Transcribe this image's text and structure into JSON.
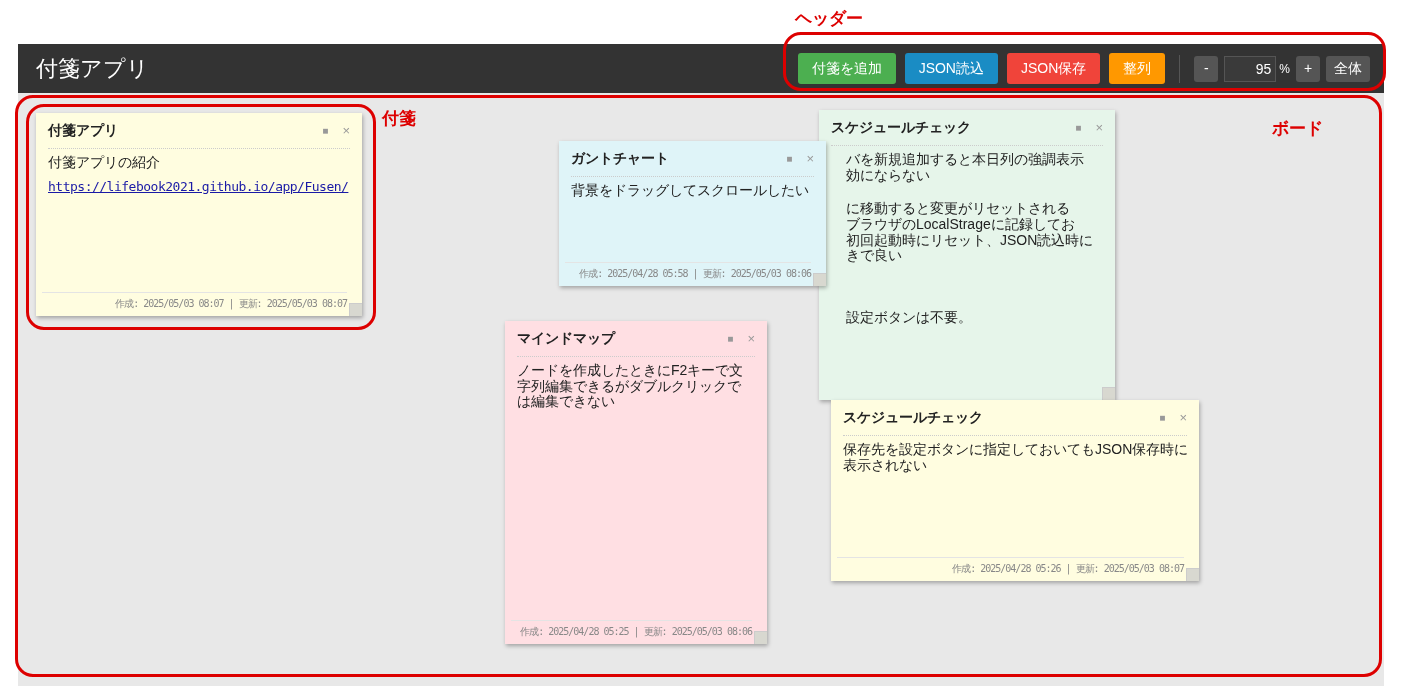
{
  "header": {
    "title": "付箋アプリ",
    "buttons": [
      {
        "label": "付箋を追加",
        "color": "#4caf50"
      },
      {
        "label": "JSON読込",
        "color": "#1a8cc4"
      },
      {
        "label": "JSON保存",
        "color": "#f0443a"
      },
      {
        "label": "整列",
        "color": "#ff9800"
      }
    ],
    "zoom": {
      "minus": "-",
      "value": "95",
      "unit": "%",
      "plus": "+",
      "fit": "全体"
    }
  },
  "notes": [
    {
      "title": "付箋アプリ",
      "color": "#fffde0",
      "minimize": "■",
      "close": "×",
      "paragraphs": [
        {
          "kind": "text",
          "lines": [
            "付箋アプリの紹介"
          ]
        },
        {
          "kind": "link",
          "lines": [
            "https://lifebook2021.github.io/app/Fusen/"
          ]
        }
      ],
      "footer": "作成: 2025/05/03 08:07 | 更新: 2025/05/03 08:07"
    },
    {
      "title": "スケジュールチェック",
      "color": "#e6f5ea",
      "minimize": "■",
      "close": "×",
      "paragraphs": [
        {
          "kind": "text",
          "lines": [
            "バを新規追加すると本日列の強調表示",
            "効にならない"
          ]
        },
        {
          "kind": "text",
          "lines": [
            "に移動すると変更がリセットされる",
            "ブラウザのLocalStrageに記録してお",
            "初回起動時にリセット、JSON読込時に",
            "きで良い"
          ]
        },
        {
          "kind": "text",
          "lines": [
            "設定ボタンは不要。"
          ]
        }
      ]
    },
    {
      "title": "ガントチャート",
      "color": "#dff4f8",
      "minimize": "■",
      "close": "×",
      "paragraphs": [
        {
          "kind": "text",
          "lines": [
            "背景をドラッグしてスクロールしたい"
          ]
        }
      ],
      "footer": "作成: 2025/04/28 05:58 | 更新: 2025/05/03 08:06"
    },
    {
      "title": "マインドマップ",
      "color": "#ffdfe3",
      "minimize": "■",
      "close": "×",
      "paragraphs": [
        {
          "kind": "text",
          "lines": [
            "ノードを作成したときにF2キーで文",
            "字列編集できるがダブルクリックで",
            "は編集できない"
          ]
        }
      ],
      "footer": "作成: 2025/04/28 05:25 | 更新: 2025/05/03 08:06"
    },
    {
      "title": "スケジュールチェック",
      "color": "#fffde0",
      "minimize": "■",
      "close": "×",
      "paragraphs": [
        {
          "kind": "text",
          "lines": [
            "保存先を設定ボタンに指定しておいてもJSON保存時に",
            "表示されない"
          ]
        }
      ],
      "footer": "作成: 2025/04/28 05:26 | 更新: 2025/05/03 08:07"
    }
  ],
  "annotations": [
    {
      "label": "ヘッダー"
    },
    {
      "label": "付箋"
    },
    {
      "label": "ボード"
    }
  ]
}
